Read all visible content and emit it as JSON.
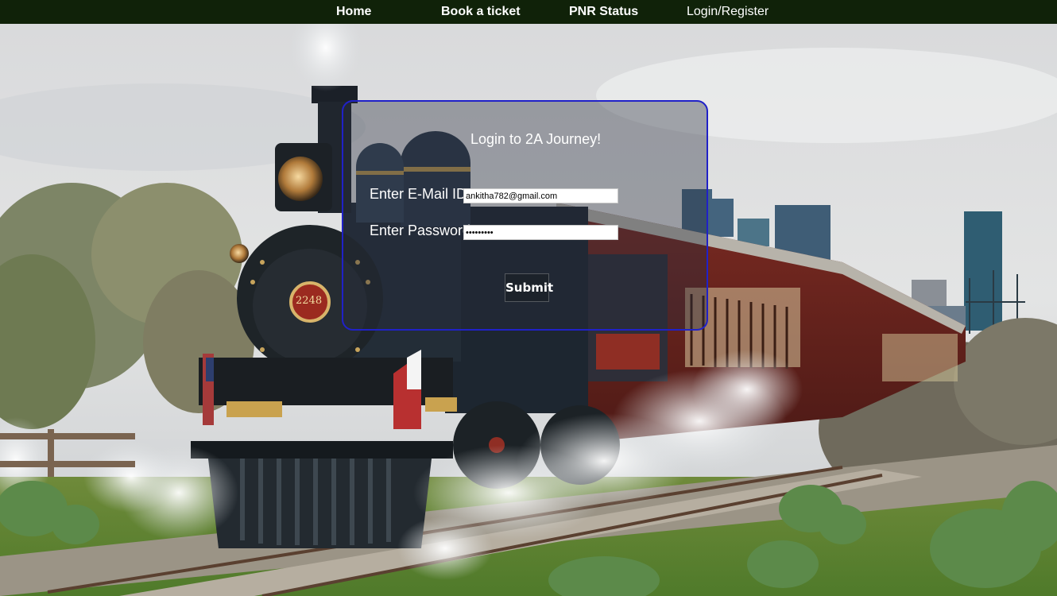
{
  "nav": {
    "home": "Home",
    "book": "Book a ticket",
    "pnr": "PNR Status",
    "login": "Login/Register"
  },
  "login": {
    "title": "Login to 2A Journey!",
    "email_label": "Enter E-Mail ID:",
    "email_value": "ankitha782@gmail.com",
    "password_label": "Enter Password:",
    "password_value": "ankitha12",
    "submit_label": "Submit"
  },
  "background": {
    "locomotive_number": "2248"
  },
  "colors": {
    "nav_bg": "#102209",
    "panel_border": "#2021c8",
    "text": "#ffffff"
  }
}
